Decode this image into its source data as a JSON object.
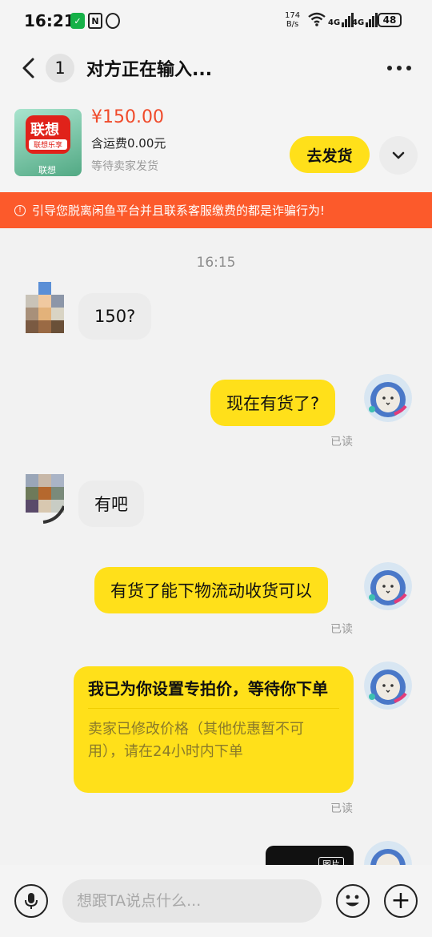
{
  "status": {
    "time": "16:21",
    "net_speed_top": "174",
    "net_speed_bottom": "B/s",
    "sig1": "4G",
    "sig2": "4G",
    "battery": "48",
    "icons": [
      "wechat-icon",
      "nfc-icon",
      "alarm-icon",
      "wifi-icon",
      "signal-icon",
      "battery-icon"
    ]
  },
  "header": {
    "unread_count": "1",
    "title": "对方正在输入..."
  },
  "product": {
    "thumb_logo": "联想",
    "thumb_slogan": "联想乐享",
    "thumb_brand": "联想",
    "price": "¥150.00",
    "shipping": "含运费0.00元",
    "status": "等待卖家发货",
    "ship_button": "去发货"
  },
  "warning": "引导您脱离闲鱼平台并且联系客服缴费的都是诈骗行为!",
  "chat": {
    "timestamp": "16:15",
    "messages": [
      {
        "side": "left",
        "text": "150?"
      },
      {
        "side": "right",
        "text": "现在有货了?",
        "read": "已读"
      },
      {
        "side": "left",
        "text": "有吧"
      },
      {
        "side": "right",
        "text": "有货了能下物流动收货可以",
        "read": "已读"
      }
    ],
    "offer": {
      "title": "我已为你设置专拍价，等待你下单",
      "desc": "卖家已修改价格（其他优惠暂不可用），请在24小时内下单",
      "read": "已读"
    },
    "image_label": "图片"
  },
  "composer": {
    "placeholder": "想跟TA说点什么..."
  },
  "colors": {
    "accent_yellow": "#ffe01a",
    "price_red": "#f04a2a",
    "warning_orange": "#fc5a2b"
  }
}
